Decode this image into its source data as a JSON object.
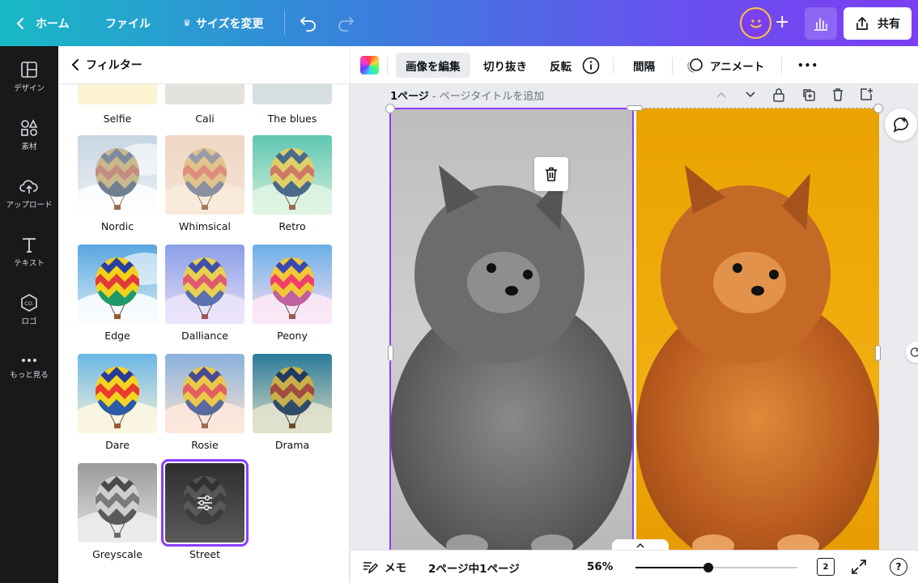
{
  "topbar": {
    "home_label": "ホーム",
    "file_label": "ファイル",
    "resize_label": "サイズを変更",
    "share_label": "共有",
    "plus_label": "+"
  },
  "rail": {
    "items": [
      {
        "label": "デザイン",
        "icon": "layout-icon"
      },
      {
        "label": "素材",
        "icon": "shapes-icon"
      },
      {
        "label": "アップロード",
        "icon": "cloud-upload-icon"
      },
      {
        "label": "テキスト",
        "icon": "text-icon"
      },
      {
        "label": "ロゴ",
        "icon": "logo-icon"
      },
      {
        "label": "もっと見る",
        "icon": "more-icon"
      }
    ]
  },
  "panel": {
    "title": "フィルター",
    "top_partial": [
      "Selfie",
      "Cali",
      "The blues"
    ],
    "filters": [
      {
        "name": "Nordic"
      },
      {
        "name": "Whimsical"
      },
      {
        "name": "Retro"
      },
      {
        "name": "Edge"
      },
      {
        "name": "Dalliance"
      },
      {
        "name": "Peony"
      },
      {
        "name": "Dare"
      },
      {
        "name": "Rosie"
      },
      {
        "name": "Drama"
      },
      {
        "name": "Greyscale"
      },
      {
        "name": "Street"
      }
    ],
    "selected": "Street"
  },
  "context_toolbar": {
    "edit_image": "画像を編集",
    "crop": "切り抜き",
    "flip": "反転",
    "spacing": "間隔",
    "animate": "アニメート",
    "more": "•••"
  },
  "canvas": {
    "page_label": "1ページ",
    "page_separator": " - ",
    "page_title_placeholder": "ページタイトルを追加"
  },
  "footer": {
    "notes_label": "メモ",
    "page_indicator": "2ページ中1ページ",
    "zoom": "56%",
    "zoom_fraction": 0.45,
    "page_count": "2",
    "help": "?"
  },
  "colors": {
    "accent": "#8b3dff",
    "avatar_ring": "#ffc53d",
    "photo_bg_right": "#f1ae10"
  }
}
